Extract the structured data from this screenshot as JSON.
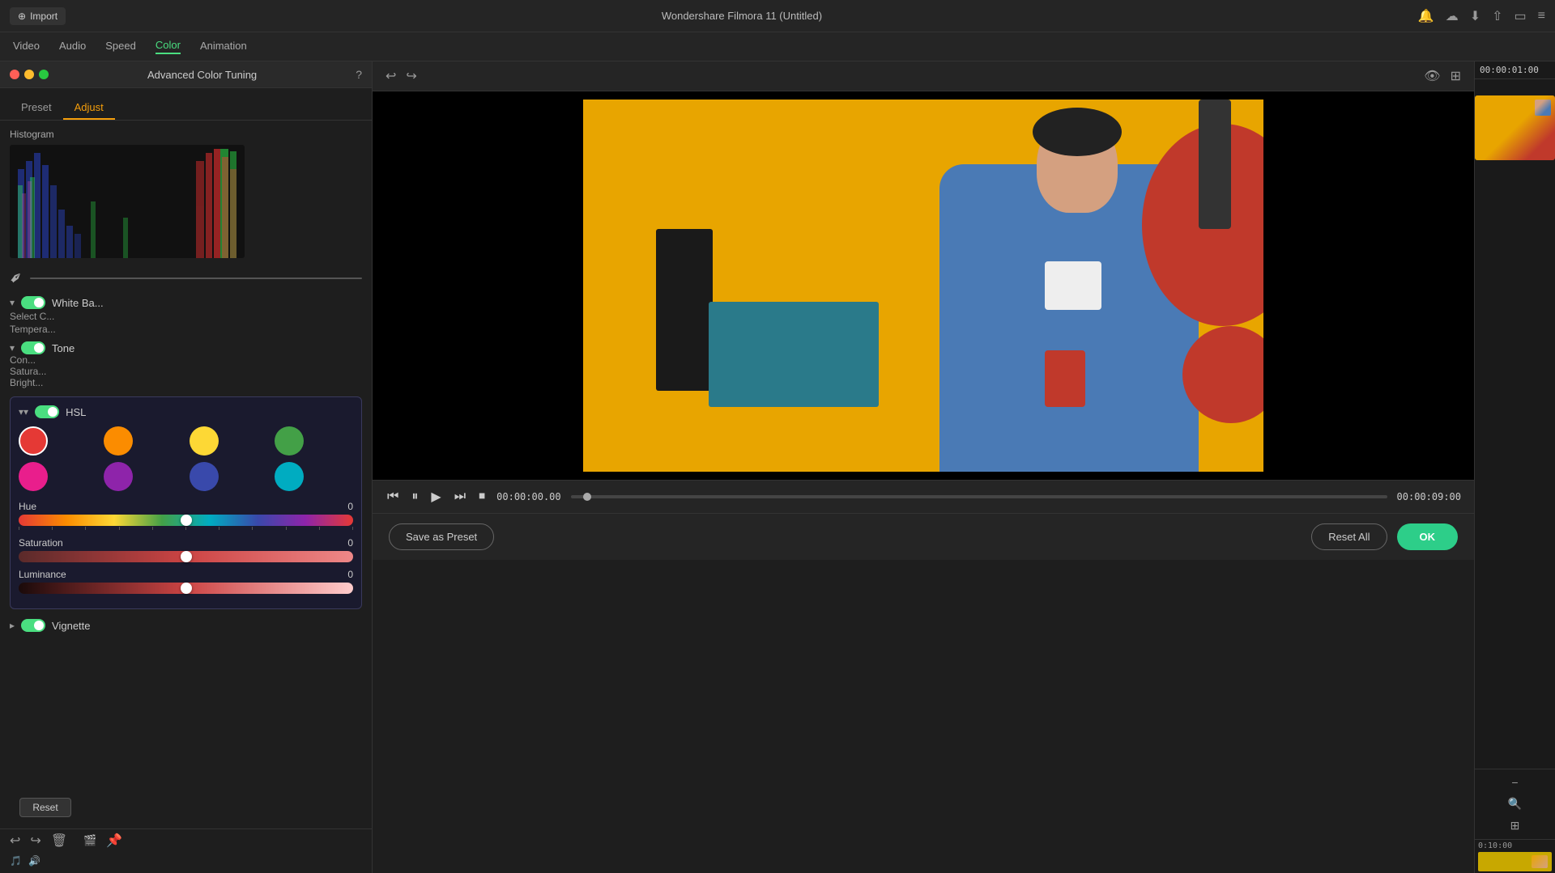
{
  "app": {
    "title": "Wondershare Filmora 11 (Untitled)",
    "import_label": "Import"
  },
  "nav": {
    "tabs": [
      {
        "label": "Video",
        "active": false
      },
      {
        "label": "Audio",
        "active": false
      },
      {
        "label": "Speed",
        "active": false
      },
      {
        "label": "Color",
        "active": true
      },
      {
        "label": "Animation",
        "active": false
      }
    ]
  },
  "dialog": {
    "title": "Advanced Color Tuning",
    "traffic_lights": [
      "red",
      "yellow",
      "green"
    ]
  },
  "sub_tabs": {
    "preset_label": "Preset",
    "adjust_label": "Adjust",
    "active": "Adjust"
  },
  "histogram": {
    "label": "Histogram"
  },
  "white_balance": {
    "label": "White Ba...",
    "enabled": true
  },
  "select_color": {
    "label": "Select C..."
  },
  "temperature": {
    "label": "Tempera..."
  },
  "tone": {
    "label": "Tone",
    "enabled": true
  },
  "controls": {
    "contrast_label": "Con...",
    "saturation_label": "Satura...",
    "brightness_label": "Bright..."
  },
  "reset_btn": {
    "label": "Reset"
  },
  "hsl": {
    "label": "HSL",
    "enabled": true,
    "swatches": [
      {
        "color": "#e53935",
        "name": "red",
        "selected": true
      },
      {
        "color": "#fb8c00",
        "name": "orange",
        "selected": false
      },
      {
        "color": "#fdd835",
        "name": "yellow",
        "selected": false
      },
      {
        "color": "#43a047",
        "name": "green",
        "selected": false
      },
      {
        "color": "#e91e8c",
        "name": "pink",
        "selected": false
      },
      {
        "color": "#8e24aa",
        "name": "purple",
        "selected": false
      },
      {
        "color": "#3949ab",
        "name": "blue",
        "selected": false
      },
      {
        "color": "#00acc1",
        "name": "cyan",
        "selected": false
      }
    ],
    "hue": {
      "label": "Hue",
      "value": 0,
      "position_pct": 50
    },
    "saturation": {
      "label": "Saturation",
      "value": 0,
      "position_pct": 50
    },
    "luminance": {
      "label": "Luminance",
      "value": 0,
      "position_pct": 50
    }
  },
  "vignette": {
    "label": "Vignette",
    "enabled": true
  },
  "video": {
    "current_time": "00:00:00.00",
    "end_time": "00:00:09:00"
  },
  "bottom_actions": {
    "save_preset": "Save as Preset",
    "reset_all": "Reset All",
    "ok": "OK"
  },
  "icons": {
    "undo": "↩",
    "redo": "↪",
    "eye": "👁",
    "import": "⊕",
    "play": "▶",
    "pause": "⏸",
    "step_forward": "⏭",
    "stop": "⏹",
    "rewind": "⏮",
    "zoom_in": "⊕",
    "zoom_out": "⊖",
    "grid": "⊞",
    "question": "?",
    "settings": "⚙",
    "camera": "📷",
    "audio": "🔊",
    "film": "🎬"
  }
}
